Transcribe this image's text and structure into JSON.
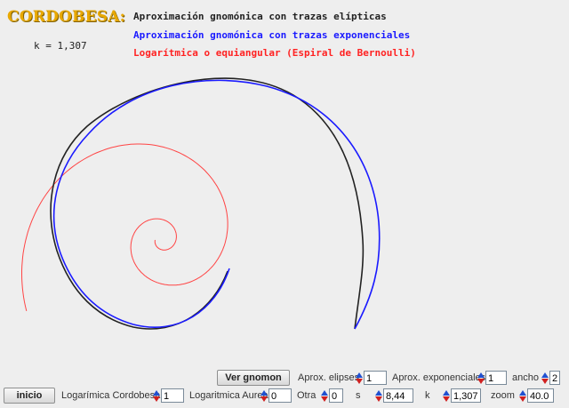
{
  "header": {
    "title": "CORDOBESA:",
    "k_readout": "k = 1,307"
  },
  "legend": {
    "elliptic": "Aproximación gnomónica con trazas elípticas",
    "exponential": "Aproximación gnomónica con trazas exponenciales",
    "logarithmic": "Logarítmica o equiangular (Espiral de Bernoulli)"
  },
  "colors": {
    "elliptic": "#222222",
    "exponential": "#1a1aff",
    "logarithmic": "#ff4444",
    "title": "#e8a800"
  },
  "controls": {
    "ver_gnomon_label": "Ver gnomon",
    "aprox_elipses_label": "Aprox. elipses",
    "aprox_elipses_value": "1",
    "aprox_exponenciales_label": "Aprox. exponenciales",
    "aprox_exponenciales_value": "1",
    "ancho_label": "ancho",
    "ancho_value": "2",
    "inicio_label": "inicio",
    "log_cordobesa_label": "Logarímica Cordobesa",
    "log_cordobesa_value": "1",
    "log_aurea_label": "Logaritmica Aurea",
    "log_aurea_value": "0",
    "otra_label": "Otra",
    "otra_value": "0",
    "s_label": "s",
    "s_value": "8,44",
    "k_label": "k",
    "k_value": "1,307",
    "zoom_label": "zoom",
    "zoom_value": "40.0"
  }
}
